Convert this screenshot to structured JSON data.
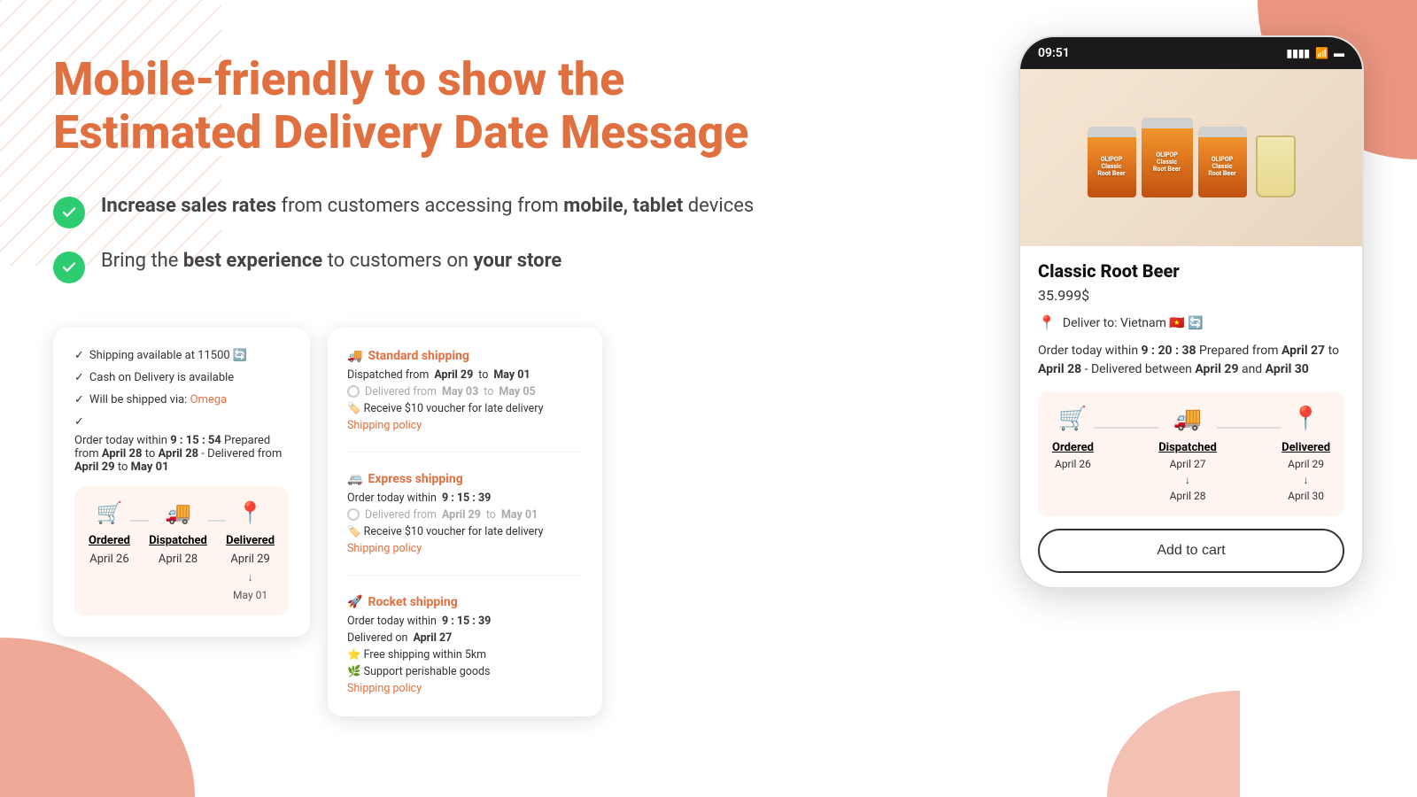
{
  "page": {
    "title": "Mobile-friendly to show the Estimated Delivery Date Message",
    "features": [
      {
        "id": "feature-1",
        "text_before": "Increase sales rates",
        "text_bold": "Increase sales rates",
        "text_after": " from customers accessing from ",
        "text_bold2": "mobile, tablet",
        "text_end": " devices",
        "full": "Increase sales rates from customers accessing from mobile, tablet devices"
      },
      {
        "id": "feature-2",
        "text_before": "Bring the ",
        "text_bold": "best experience",
        "text_after": " to customers on ",
        "text_bold2": "your store",
        "full": "Bring the best experience to customers on your store"
      }
    ]
  },
  "widget_card": {
    "shipping_available": "Shipping available at 11500",
    "cash_on_delivery": "Cash on Delivery is available",
    "shipped_via": "Will be shipped via:",
    "shipped_via_link": "Omega",
    "order_today": "Order today within",
    "countdown": "9 : 15 : 54",
    "prepared_text": "Prepared from",
    "prepared_from": "April 28",
    "prepared_to": "April 28",
    "delivered_from": "April 29",
    "delivered_to": "May 01",
    "timeline": {
      "step1_label": "Ordered",
      "step1_date": "April 26",
      "step2_label": "Dispatched",
      "step2_date": "April 28",
      "step3_label": "Delivered",
      "step3_date": "April 29",
      "step3_date2": "↓",
      "step3_date3": "May 01"
    }
  },
  "shipping_card": {
    "options": [
      {
        "icon": "🚚",
        "title": "Standard shipping",
        "dispatched_label": "Dispatched from",
        "dispatched_from": "April 29",
        "dispatched_to": "May 01",
        "delivered_label": "Delivered from",
        "delivered_from": "May 03",
        "delivered_to": "May 05",
        "voucher": "🏷️ Receive $10 voucher for late delivery",
        "policy_link": "Shipping policy"
      },
      {
        "icon": "🚐",
        "title": "Express shipping",
        "order_today": "Order today within",
        "countdown": "9 : 15 : 39",
        "delivered_label": "Delivered from",
        "delivered_from": "April 29",
        "delivered_to": "May 01",
        "voucher": "🏷️ Receive $10 voucher for late delivery",
        "policy_link": "Shipping policy"
      },
      {
        "icon": "🚀",
        "title": "Rocket shipping",
        "order_today": "Order today within",
        "countdown": "9 : 15 : 39",
        "delivered_label": "Delivered on",
        "delivered_on": "April 27",
        "free_shipping": "⭐ Free shipping within 5km",
        "support": "🌿 Support perishable goods",
        "policy_link": "Shipping policy"
      }
    ]
  },
  "phone": {
    "status_bar": {
      "time": "09:51",
      "signal": "📶",
      "wifi": "WiFi",
      "battery": "🔋"
    },
    "product": {
      "name": "Classic Root Beer",
      "price": "35.999$"
    },
    "delivery": {
      "deliver_to": "Deliver to: Vietnam 🇻🇳",
      "order_today": "Order today within",
      "countdown": "9 : 20 : 38",
      "prepared_from": "April 27",
      "prepared_to": "April 28",
      "delivered_between_from": "April 29",
      "delivered_between_to": "April 30"
    },
    "timeline": {
      "step1_label": "Ordered",
      "step1_date": "April 26",
      "step2_label": "Dispatched",
      "step2_date": "April 27",
      "step2_date2": "↓",
      "step2_date3": "April 28",
      "step3_label": "Delivered",
      "step3_date": "April 29",
      "step3_date2": "↓",
      "step3_date3": "April 30"
    },
    "add_to_cart": "Add to cart"
  },
  "colors": {
    "accent": "#e07040",
    "green": "#2ecc71",
    "light_orange_bg": "#fff5f0"
  }
}
